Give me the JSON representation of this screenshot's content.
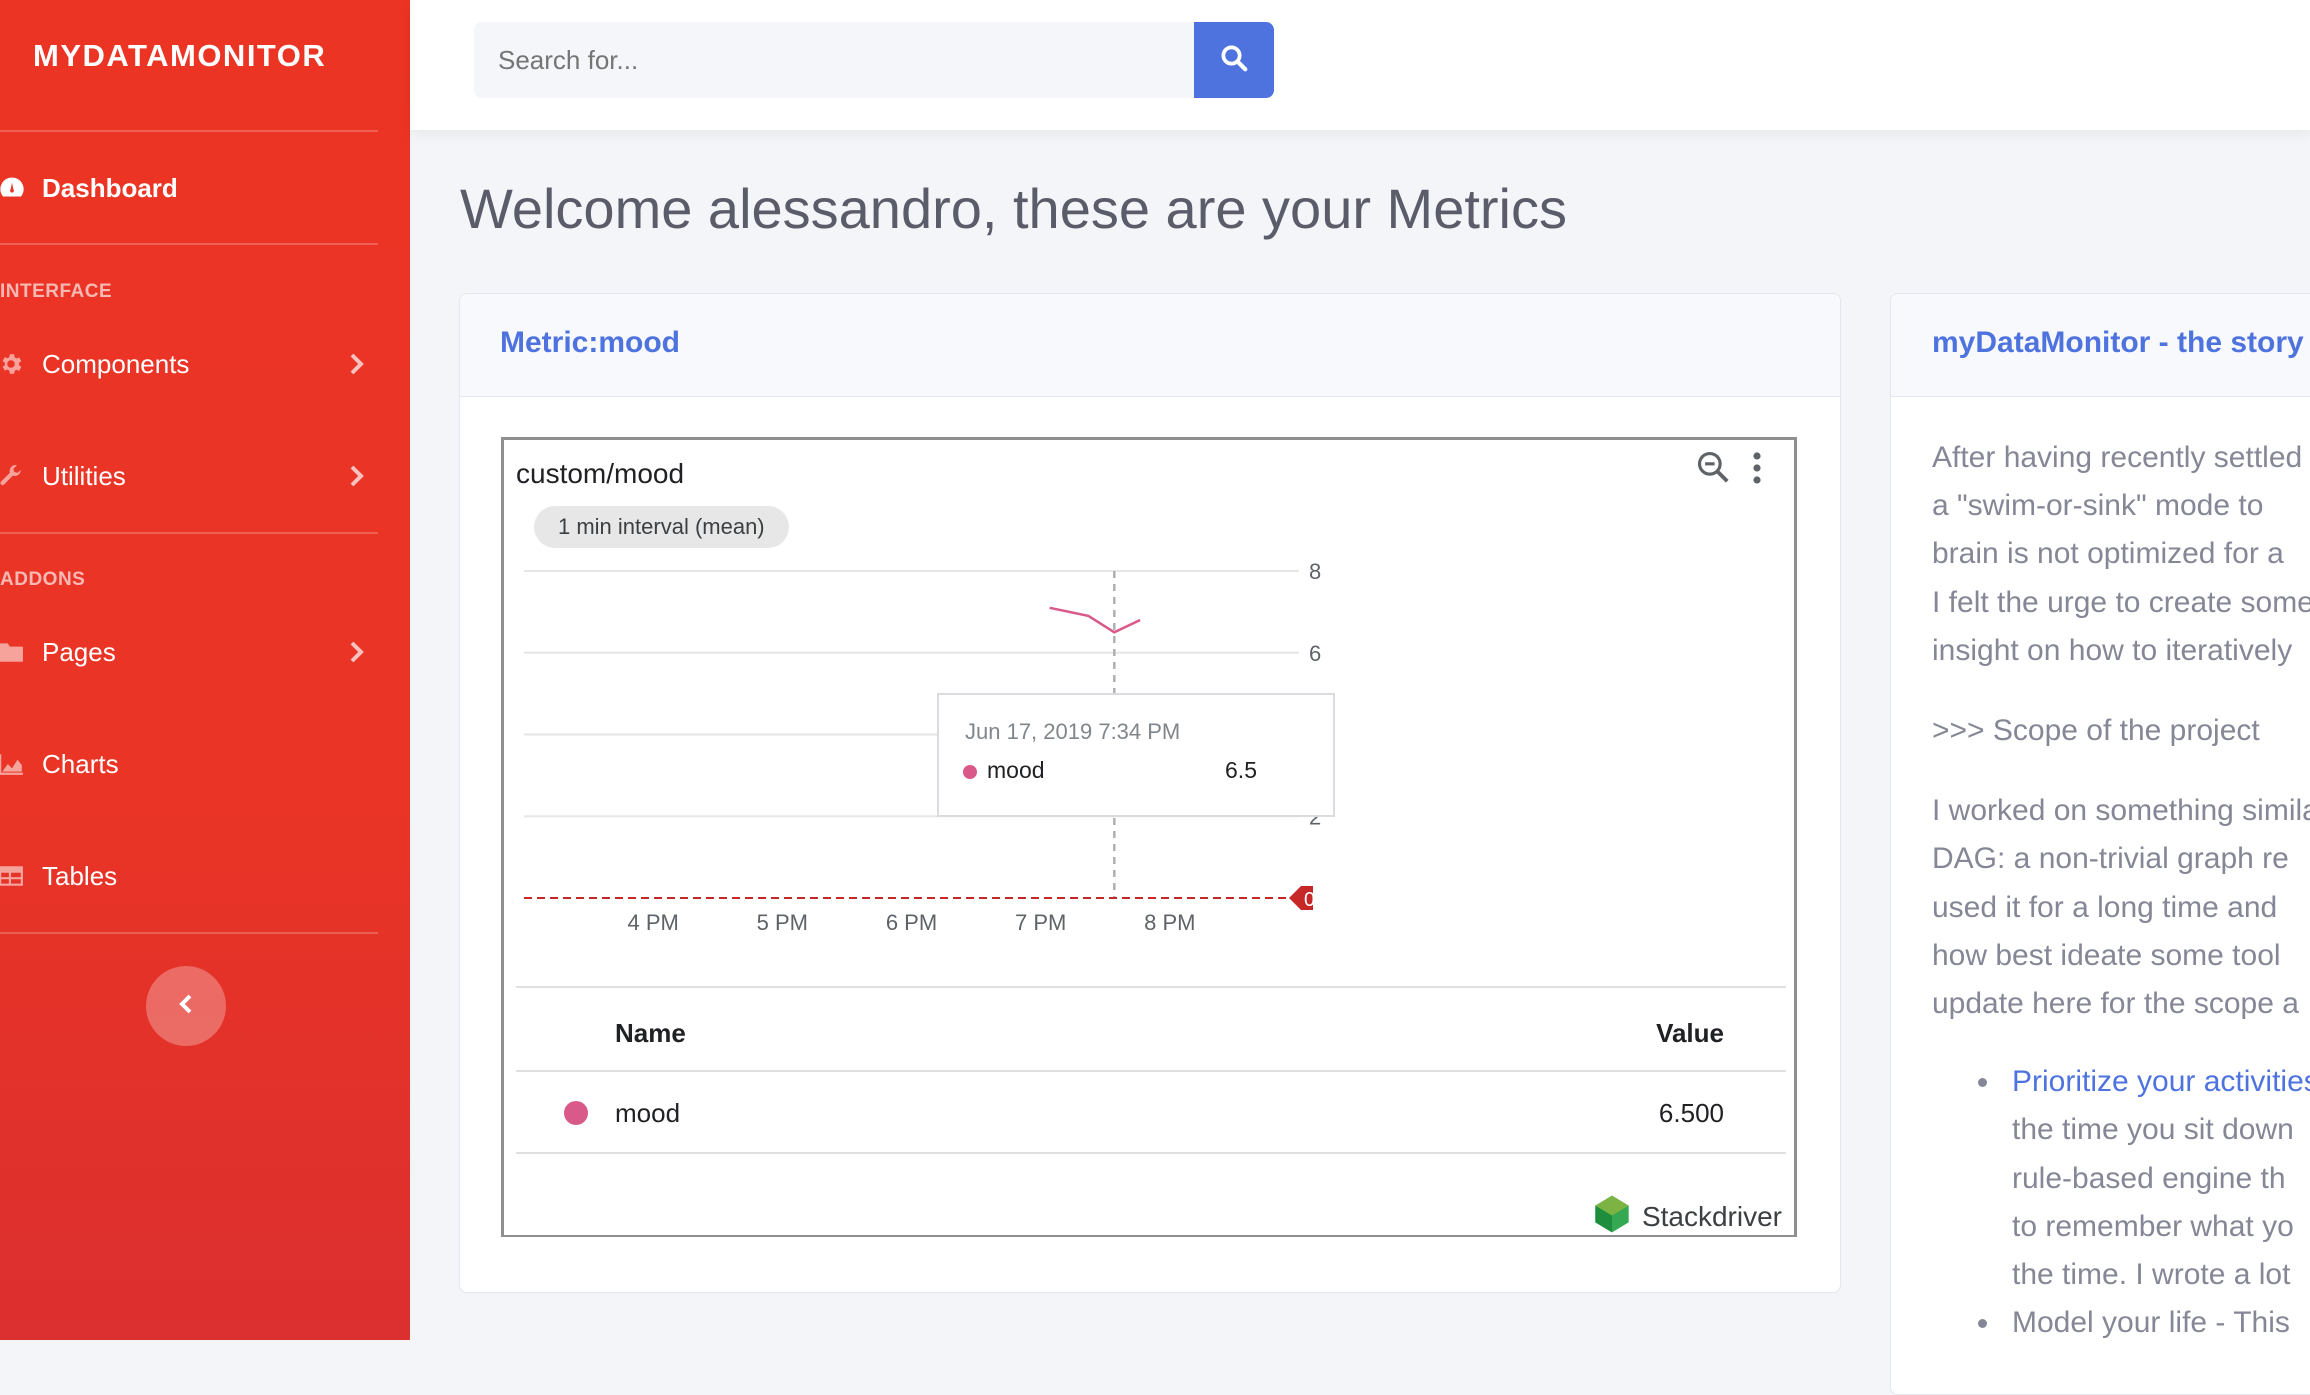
{
  "sidebar": {
    "brand": "MYDATAMONITOR",
    "dashboard": "Dashboard",
    "heading_interface": "INTERFACE",
    "components": "Components",
    "utilities": "Utilities",
    "heading_addons": "ADDONS",
    "pages": "Pages",
    "charts": "Charts",
    "tables": "Tables"
  },
  "search": {
    "placeholder": "Search for..."
  },
  "page_title": "Welcome alessandro, these are your Metrics",
  "metric_card": {
    "title": "Metric:mood",
    "widget_title": "custom/mood",
    "interval": "1 min interval (mean)",
    "tooltip": {
      "time": "Jun 17, 2019 7:34 PM",
      "series": "mood",
      "value": "6.5"
    },
    "table": {
      "col_name": "Name",
      "col_value": "Value",
      "rows": [
        {
          "name": "mood",
          "value": "6.500"
        }
      ]
    },
    "branding": "Stackdriver",
    "series_color": "#d9598a",
    "threshold_color": "#c62828"
  },
  "chart_data": {
    "type": "line",
    "title": "custom/mood",
    "xlabel": "",
    "ylabel": "",
    "x_ticks": [
      "4 PM",
      "5 PM",
      "6 PM",
      "7 PM",
      "8 PM"
    ],
    "y_ticks": [
      "0",
      "2",
      "4",
      "6",
      "8"
    ],
    "ylim": [
      0,
      8
    ],
    "xlim_hours": [
      15.0,
      21.0
    ],
    "series": [
      {
        "name": "mood",
        "x": [
          19.07,
          19.37,
          19.57,
          19.77
        ],
        "values": [
          7.1,
          6.9,
          6.5,
          6.8
        ]
      }
    ],
    "threshold": 0,
    "cursor_x": 19.57,
    "grid": true
  },
  "story_card": {
    "title": "myDataMonitor - the story",
    "lines": [
      "After having recently settled",
      "a \"swim-or-sink\" mode to",
      "brain is not optimized for a",
      "I felt the urge to create some",
      "insight on how to iteratively"
    ],
    "scope": ">>> Scope of the project",
    "lines2": [
      "I worked on something similar",
      "DAG: a non-trivial graph re",
      "used it for a long time and",
      "how best ideate some tool",
      "update here for the scope a"
    ],
    "bullet1": {
      "link": "Prioritize your activities",
      "lines": [
        "the time you sit down",
        "rule-based engine th",
        "to remember what yo",
        "the time. I wrote a lot"
      ]
    },
    "bullet2": "Model your life - This"
  }
}
